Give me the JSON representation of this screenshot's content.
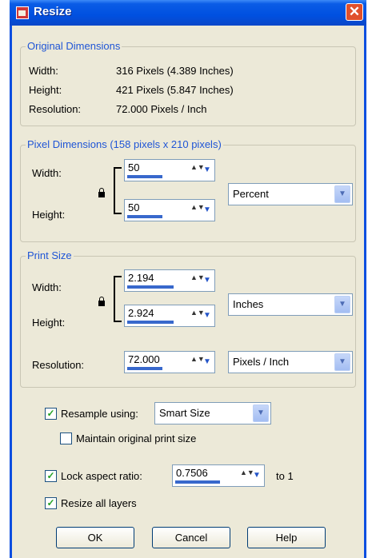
{
  "title_bar": {
    "title": "Resize",
    "close_glyph": "✕"
  },
  "original": {
    "legend": "Original Dimensions",
    "width_label": "Width:",
    "width_value": "316 Pixels (4.389 Inches)",
    "height_label": "Height:",
    "height_value": "421 Pixels (5.847 Inches)",
    "resolution_label": "Resolution:",
    "resolution_value": "72.000 Pixels / Inch"
  },
  "pixel": {
    "legend": "Pixel Dimensions (158 pixels x 210 pixels)",
    "width_label": "Width:",
    "width_value": "50",
    "height_label": "Height:",
    "height_value": "50",
    "unit": "Percent"
  },
  "print": {
    "legend": "Print Size",
    "width_label": "Width:",
    "width_value": "2.194",
    "height_label": "Height:",
    "height_value": "2.924",
    "unit": "Inches",
    "resolution_label": "Resolution:",
    "resolution_value": "72.000",
    "resolution_unit": "Pixels / Inch"
  },
  "options": {
    "resample_label": "Resample using:",
    "resample_checked": true,
    "resample_method": "Smart Size",
    "maintain_label": "Maintain original print size",
    "maintain_checked": false,
    "lock_label": "Lock aspect ratio:",
    "lock_checked": true,
    "ratio_value": "0.7506",
    "ratio_suffix": "to 1",
    "resize_all_label": "Resize all layers",
    "resize_all_checked": true
  },
  "buttons": {
    "ok": "OK",
    "cancel": "Cancel",
    "help": "Help"
  },
  "glyphs": {
    "check": "✓",
    "spin": "▲▼",
    "dropdown": "▼"
  },
  "colors": {
    "title_bar": "#0050e0",
    "legend_text": "#1f55d6",
    "dialog_bg": "#ece9d8",
    "close_button": "#e0502c"
  }
}
